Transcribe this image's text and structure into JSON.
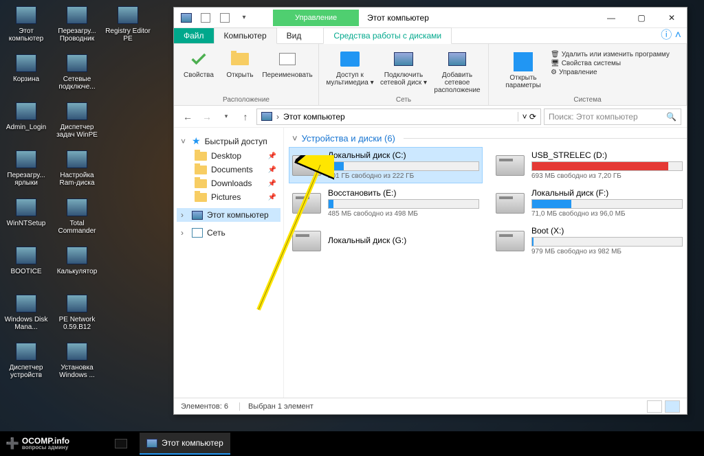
{
  "desktop_icons": [
    {
      "label": "Этот компьютер"
    },
    {
      "label": "Перезагру... Проводник"
    },
    {
      "label": "Registry Editor PE"
    },
    {
      "label": "Корзина"
    },
    {
      "label": "Сетевые подключе..."
    },
    {
      "label": ""
    },
    {
      "label": "Admin_Login"
    },
    {
      "label": "Диспетчер задач WinPE"
    },
    {
      "label": ""
    },
    {
      "label": "Перезагру... ярлыки"
    },
    {
      "label": "Настройка Ram-диска"
    },
    {
      "label": ""
    },
    {
      "label": "WinNTSetup"
    },
    {
      "label": "Total Commander"
    },
    {
      "label": ""
    },
    {
      "label": "BOOTICE"
    },
    {
      "label": "Калькулятор"
    },
    {
      "label": ""
    },
    {
      "label": "Windows Disk Mana..."
    },
    {
      "label": "PE Network 0.59.B12"
    },
    {
      "label": ""
    },
    {
      "label": "Диспетчер устройств"
    },
    {
      "label": "Установка Windows ..."
    },
    {
      "label": ""
    }
  ],
  "window": {
    "ctx_tab_top": "Управление",
    "title": "Этот компьютер",
    "tabs": {
      "file": "Файл",
      "computer": "Компьютер",
      "view": "Вид",
      "ctx": "Средства работы с дисками"
    },
    "ribbon": {
      "group_location": {
        "label": "Расположение",
        "items": [
          "Свойства",
          "Открыть",
          "Переименовать"
        ]
      },
      "group_network": {
        "label": "Сеть",
        "items": [
          "Доступ к мультимедиа",
          "Подключить сетевой диск",
          "Добавить сетевое расположение"
        ]
      },
      "group_system": {
        "label": "Система",
        "big": "Открыть параметры",
        "links": [
          "Удалить или изменить программу",
          "Свойства системы",
          "Управление"
        ]
      }
    },
    "address": "Этот компьютер",
    "search_placeholder": "Поиск: Этот компьютер",
    "nav": {
      "quick": "Быстрый доступ",
      "quick_items": [
        "Desktop",
        "Documents",
        "Downloads",
        "Pictures"
      ],
      "this_pc": "Этот компьютер",
      "network": "Сеть"
    },
    "group_header": "Устройства и диски (6)",
    "status": {
      "count": "Элементов: 6",
      "sel": "Выбран 1 элемент"
    }
  },
  "drives": [
    {
      "name": "Локальный диск (C:)",
      "free": "201 ГБ свободно из 222 ГБ",
      "pct": 10,
      "color": "#2196f3",
      "sel": true
    },
    {
      "name": "USB_STRELEC (D:)",
      "free": "693 МБ свободно из 7,20 ГБ",
      "pct": 91,
      "color": "#e53935"
    },
    {
      "name": "Восстановить (E:)",
      "free": "485 МБ свободно из 498 МБ",
      "pct": 3,
      "color": "#2196f3"
    },
    {
      "name": "Локальный диск (F:)",
      "free": "71,0 МБ свободно из 96,0 МБ",
      "pct": 26,
      "color": "#2196f3"
    },
    {
      "name": "Локальный диск (G:)",
      "free": "",
      "pct": 0,
      "color": "#2196f3",
      "nobar": true
    },
    {
      "name": "Boot (X:)",
      "free": "979 МБ свободно из 982 МБ",
      "pct": 1,
      "color": "#2196f3"
    }
  ],
  "taskbar": {
    "brand": "OCOMP.info",
    "brand_sub": "вопросы админу",
    "app": "Этот компьютер"
  }
}
